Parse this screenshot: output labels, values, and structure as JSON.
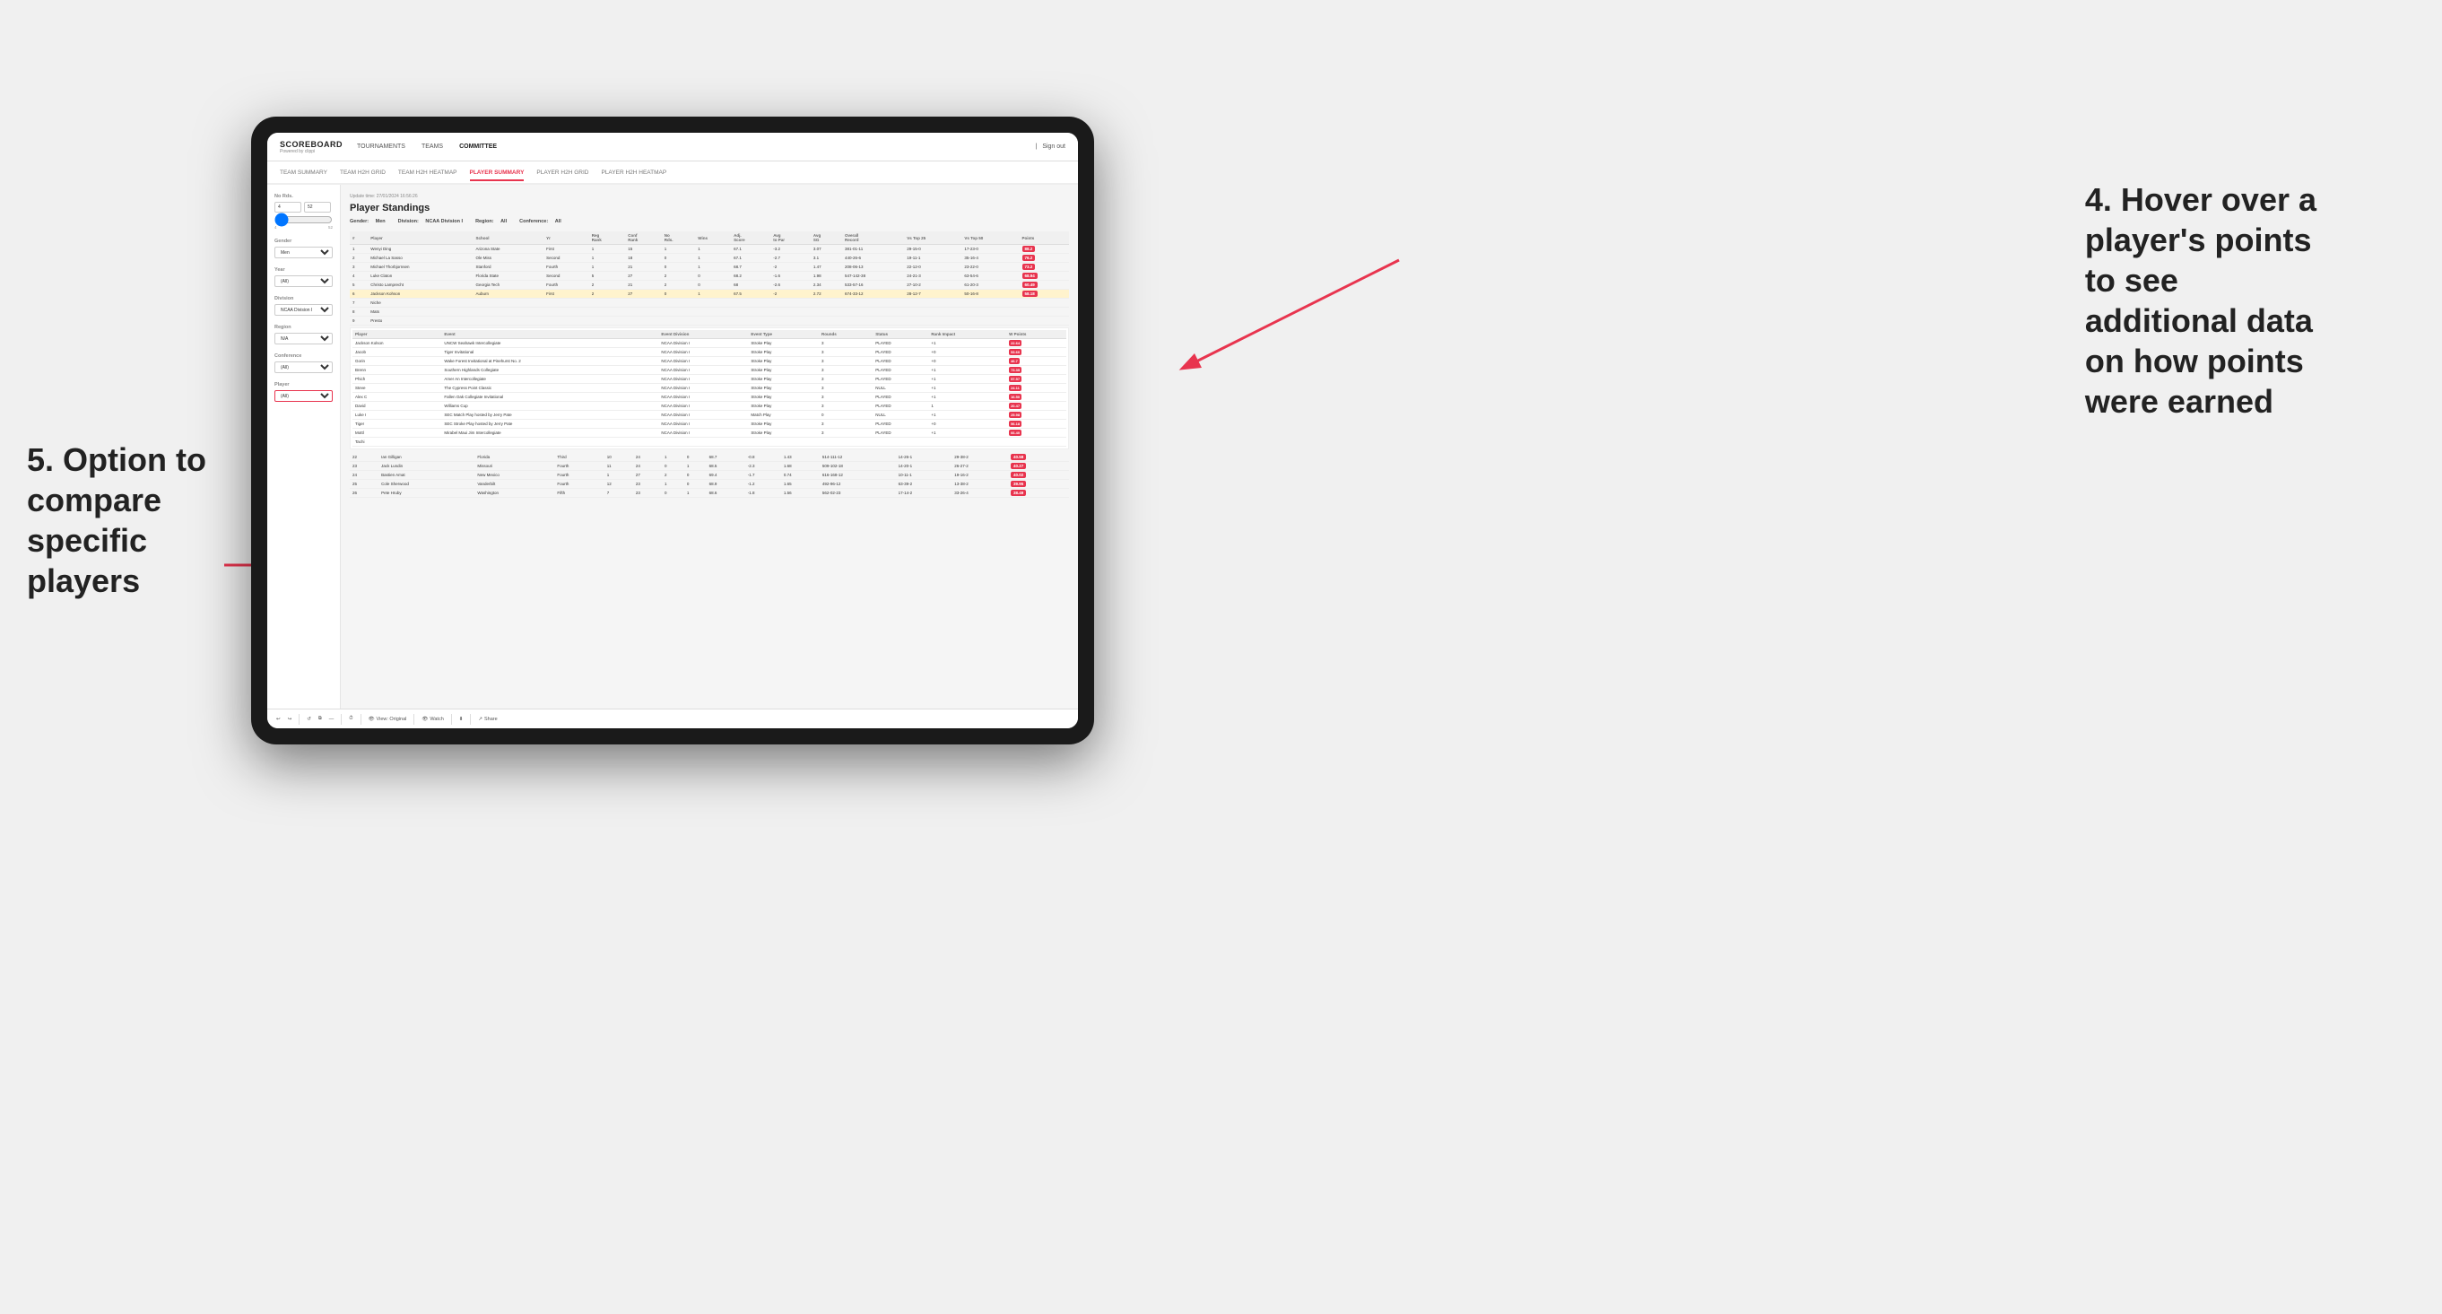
{
  "app": {
    "logo": "SCOREBOARD",
    "logo_sub": "Powered by clippi",
    "nav": [
      "TOURNAMENTS",
      "TEAMS",
      "COMMITTEE"
    ],
    "sign_out": "Sign out",
    "sub_nav": [
      "TEAM SUMMARY",
      "TEAM H2H GRID",
      "TEAM H2H HEATMAP",
      "PLAYER SUMMARY",
      "PLAYER H2H GRID",
      "PLAYER H2H HEATMAP"
    ],
    "active_sub": "PLAYER SUMMARY"
  },
  "sidebar": {
    "no_rds_label": "No Rds.",
    "no_rds_min": "4",
    "no_rds_max": "52",
    "gender_label": "Gender",
    "gender_value": "Men",
    "year_label": "Year",
    "year_value": "(All)",
    "division_label": "Division",
    "division_value": "NCAA Division I",
    "region_label": "Region",
    "region_value": "N/A",
    "conference_label": "Conference",
    "conference_value": "(All)",
    "player_label": "Player",
    "player_value": "(All)"
  },
  "content": {
    "update_time": "Update time: 27/01/2024 16:56:26",
    "title": "Player Standings",
    "filters": {
      "gender_label": "Gender:",
      "gender_value": "Men",
      "division_label": "Division:",
      "division_value": "NCAA Division I",
      "region_label": "Region:",
      "region_value": "All",
      "conference_label": "Conference:",
      "conference_value": "All"
    }
  },
  "table_headers": [
    "#",
    "Player",
    "School",
    "Yr",
    "Reg Rank",
    "Conf Rank",
    "No Rds.",
    "Wins",
    "Adj. Score",
    "Avg to Par",
    "Avg SG",
    "Overall Record",
    "Vs Top 25",
    "Vs Top 50",
    "Points"
  ],
  "players": [
    {
      "rank": 1,
      "name": "Wenyi Ding",
      "school": "Arizona State",
      "yr": "First",
      "reg_rank": 1,
      "conf_rank": 15,
      "rds": 1,
      "wins": 1,
      "adj_score": 67.1,
      "to_par": -3.2,
      "avg_sg": 3.07,
      "record": "381-01-11",
      "vs25": "29-15-0",
      "vs50": "17-23-0",
      "points": "88.2"
    },
    {
      "rank": 2,
      "name": "Michael La Sasso",
      "school": "Ole Miss",
      "yr": "Second",
      "reg_rank": 1,
      "conf_rank": 18,
      "rds": 0,
      "wins": 1,
      "adj_score": 67.1,
      "to_par": -2.7,
      "avg_sg": 3.1,
      "record": "440-26-6",
      "vs25": "19-11-1",
      "vs50": "35-16-4",
      "points": "76.2"
    },
    {
      "rank": 3,
      "name": "Michael Thorbjornsen",
      "school": "Stanford",
      "yr": "Fourth",
      "reg_rank": 1,
      "conf_rank": 21,
      "rds": 0,
      "wins": 1,
      "adj_score": 68.7,
      "to_par": -2.0,
      "avg_sg": 1.47,
      "record": "208-06-13",
      "vs25": "22-12-0",
      "vs50": "23-22-0",
      "points": "73.2"
    },
    {
      "rank": 4,
      "name": "Luke Claton",
      "school": "Florida State",
      "yr": "Second",
      "reg_rank": 5,
      "conf_rank": 27,
      "rds": 2,
      "wins": 0,
      "adj_score": 68.2,
      "to_par": -1.6,
      "avg_sg": 1.98,
      "record": "547-142-38",
      "vs25": "24-21-3",
      "vs50": "63-54-6",
      "points": "68.94"
    },
    {
      "rank": 5,
      "name": "Christo Lamprecht",
      "school": "Georgia Tech",
      "yr": "Fourth",
      "reg_rank": 2,
      "conf_rank": 21,
      "rds": 2,
      "wins": 0,
      "adj_score": 68.0,
      "to_par": -2.6,
      "avg_sg": 2.34,
      "record": "533-57-16",
      "vs25": "27-10-2",
      "vs50": "61-20-3",
      "points": "60.49"
    },
    {
      "rank": 6,
      "name": "Jackson Kohson",
      "school": "Auburn",
      "yr": "First",
      "reg_rank": 2,
      "conf_rank": 27,
      "rds": 0,
      "wins": 1,
      "adj_score": 67.5,
      "to_par": -2.0,
      "avg_sg": 2.72,
      "record": "674-33-12",
      "vs25": "28-12-7",
      "vs50": "50-16-8",
      "points": "58.18"
    },
    {
      "rank": 7,
      "name": "Niche",
      "school": "",
      "yr": "",
      "reg_rank": null,
      "conf_rank": null,
      "rds": null,
      "wins": null,
      "adj_score": null,
      "to_par": null,
      "avg_sg": null,
      "record": "",
      "vs25": "",
      "vs50": "",
      "points": ""
    },
    {
      "rank": 8,
      "name": "Mats",
      "school": "",
      "yr": "",
      "reg_rank": null,
      "conf_rank": null,
      "rds": null,
      "wins": null,
      "adj_score": null,
      "to_par": null,
      "avg_sg": null,
      "record": "",
      "vs25": "",
      "vs50": "",
      "points": ""
    },
    {
      "rank": 9,
      "name": "Presto",
      "school": "",
      "yr": "",
      "reg_rank": null,
      "conf_rank": null,
      "rds": null,
      "wins": null,
      "adj_score": null,
      "to_par": null,
      "avg_sg": null,
      "record": "",
      "vs25": "",
      "vs50": "",
      "points": ""
    }
  ],
  "tooltip_player": "Jackson Kolson",
  "tooltip_rows": [
    {
      "player": "Jackson Kolson",
      "event": "UNCW Seahawk Intercollegiate",
      "division": "NCAA Division I",
      "type": "Stroke Play",
      "rounds": 3,
      "status": "PLAYED",
      "rank_impact": "+1",
      "points": "22.64"
    },
    {
      "player": "Jacob",
      "event": "Tiger Invitational",
      "division": "NCAA Division I",
      "type": "Stroke Play",
      "rounds": 3,
      "status": "PLAYED",
      "rank_impact": "+0",
      "points": "53.60"
    },
    {
      "player": "Gorin",
      "event": "Wake Forest Invitational at Pinehurst No. 2",
      "division": "NCAA Division I",
      "type": "Stroke Play",
      "rounds": 3,
      "status": "PLAYED",
      "rank_impact": "+0",
      "points": "46.7"
    },
    {
      "player": "Brenn",
      "event": "Southern Highlands Collegiate",
      "division": "NCAA Division I",
      "type": "Stroke Play",
      "rounds": 3,
      "status": "PLAYED",
      "rank_impact": "+1",
      "points": "73.35"
    },
    {
      "player": "Phich",
      "event": "Amer An Intercollegiate",
      "division": "NCAA Division I",
      "type": "Stroke Play",
      "rounds": 3,
      "status": "PLAYED",
      "rank_impact": "+1",
      "points": "57.57"
    },
    {
      "player": "Steve",
      "event": "The Cypress Point Classic",
      "division": "NCAA Division I",
      "type": "Stroke Play",
      "rounds": 3,
      "status": "NULL",
      "rank_impact": "+1",
      "points": "24.11"
    },
    {
      "player": "Alex C",
      "event": "Fallen Oak Collegiate Invitational",
      "division": "NCAA Division I",
      "type": "Stroke Play",
      "rounds": 3,
      "status": "PLAYED",
      "rank_impact": "+1",
      "points": "16.50"
    },
    {
      "player": "David",
      "event": "Williams Cup",
      "division": "NCAA Division I",
      "type": "Stroke Play",
      "rounds": 3,
      "status": "PLAYED",
      "rank_impact": "1",
      "points": "20.47"
    },
    {
      "player": "Luke I",
      "event": "SEC Match Play hosted by Jerry Pate",
      "division": "NCAA Division I",
      "type": "Match Play",
      "rounds": 0,
      "status": "NULL",
      "rank_impact": "+1",
      "points": "25.98"
    },
    {
      "player": "Tiger",
      "event": "SEC Stroke Play hosted by Jerry Pate",
      "division": "NCAA Division I",
      "type": "Stroke Play",
      "rounds": 3,
      "status": "PLAYED",
      "rank_impact": "+0",
      "points": "56.18"
    },
    {
      "player": "Mottl",
      "event": "Mirabel Maui Jim Intercollegiate",
      "division": "NCAA Division I",
      "type": "Stroke Play",
      "rounds": 3,
      "status": "PLAYED",
      "rank_impact": "+1",
      "points": "66.40"
    },
    {
      "player": "Tachi",
      "event": "",
      "division": "",
      "type": "",
      "rounds": null,
      "status": "",
      "rank_impact": "",
      "points": ""
    }
  ],
  "lower_players": [
    {
      "rank": 22,
      "name": "Ian Gilligan",
      "school": "Florida",
      "yr": "Third",
      "reg_rank": 10,
      "conf_rank": 24,
      "rds": 1,
      "wins": 0,
      "adj_score": 68.7,
      "to_par": -0.8,
      "avg_sg": 1.43,
      "record": "514-111-12",
      "vs25": "14-26-1",
      "vs50": "29-38-2",
      "points": "40.58"
    },
    {
      "rank": 23,
      "name": "Jack Lundin",
      "school": "Missouri",
      "yr": "Fourth",
      "reg_rank": 11,
      "conf_rank": 24,
      "rds": 0,
      "wins": 1,
      "adj_score": 68.5,
      "to_par": -2.3,
      "avg_sg": 1.68,
      "record": "509-102-18",
      "vs25": "14-20-1",
      "vs50": "26-27-2",
      "points": "40.27"
    },
    {
      "rank": 24,
      "name": "Bastien Amat",
      "school": "New Mexico",
      "yr": "Fourth",
      "reg_rank": 1,
      "conf_rank": 27,
      "rds": 2,
      "wins": 0,
      "adj_score": 69.4,
      "to_par": -1.7,
      "avg_sg": 0.74,
      "record": "616-168-12",
      "vs25": "10-11-1",
      "vs50": "19-16-2",
      "points": "40.02"
    },
    {
      "rank": 25,
      "name": "Cole Sherwood",
      "school": "Vanderbilt",
      "yr": "Fourth",
      "reg_rank": 12,
      "conf_rank": 23,
      "rds": 1,
      "wins": 0,
      "adj_score": 68.9,
      "to_par": -1.2,
      "avg_sg": 1.65,
      "record": "492-96-12",
      "vs25": "63-39-2",
      "vs50": "13-38-2",
      "points": "39.95"
    },
    {
      "rank": 26,
      "name": "Pete Hruby",
      "school": "Washington",
      "yr": "Fifth",
      "reg_rank": 7,
      "conf_rank": 23,
      "rds": 0,
      "wins": 1,
      "adj_score": 68.6,
      "to_par": -1.8,
      "avg_sg": 1.56,
      "record": "562-02-23",
      "vs25": "17-14-2",
      "vs50": "33-26-4",
      "points": "38.49"
    }
  ],
  "toolbar": {
    "undo": "↩",
    "redo": "↪",
    "refresh": "↻",
    "copy": "⧉",
    "dash": "—",
    "clock": "⏱",
    "view_label": "View: Original",
    "watch_label": "Watch",
    "export_label": "⬇",
    "share_label": "Share"
  },
  "annotations": {
    "top_right": "4. Hover over a\nplayer's points\nto see\nadditional data\non how points\nwere earned",
    "bottom_left": "5. Option to\ncompare\nspecific players"
  }
}
